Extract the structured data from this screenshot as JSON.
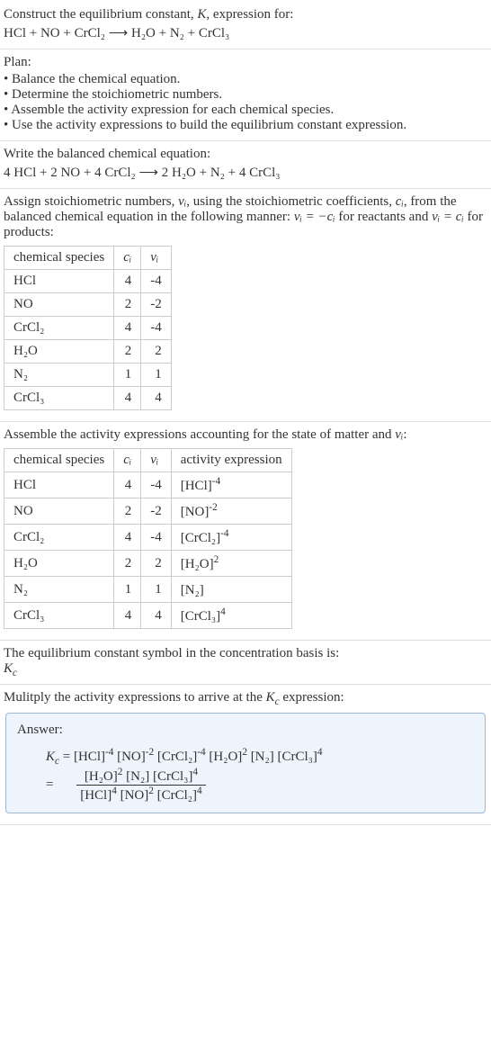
{
  "intro": {
    "line1_a": "Construct the equilibrium constant, ",
    "line1_b": ", expression for:",
    "K": "K",
    "equation": "HCl + NO + CrCl₂  ⟶  H₂O + N₂ + CrCl₃"
  },
  "plan": {
    "heading": "Plan:",
    "items": [
      "Balance the chemical equation.",
      "Determine the stoichiometric numbers.",
      "Assemble the activity expression for each chemical species.",
      "Use the activity expressions to build the equilibrium constant expression."
    ]
  },
  "balanced": {
    "heading": "Write the balanced chemical equation:",
    "equation": "4 HCl + 2 NO + 4 CrCl₂  ⟶  2 H₂O + N₂ + 4 CrCl₃"
  },
  "stoich": {
    "text_a": "Assign stoichiometric numbers, ",
    "nu_i": "νᵢ",
    "text_b": ", using the stoichiometric coefficients, ",
    "c_i": "cᵢ",
    "text_c": ", from the balanced chemical equation in the following manner: ",
    "rel1": "νᵢ = −cᵢ",
    "text_d": " for reactants and ",
    "rel2": "νᵢ = cᵢ",
    "text_e": " for products:",
    "headers": {
      "species": "chemical species",
      "c": "cᵢ",
      "nu": "νᵢ"
    },
    "rows": [
      {
        "species": "HCl",
        "c": "4",
        "nu": "-4"
      },
      {
        "species": "NO",
        "c": "2",
        "nu": "-2"
      },
      {
        "species": "CrCl₂",
        "c": "4",
        "nu": "-4"
      },
      {
        "species": "H₂O",
        "c": "2",
        "nu": "2"
      },
      {
        "species": "N₂",
        "c": "1",
        "nu": "1"
      },
      {
        "species": "CrCl₃",
        "c": "4",
        "nu": "4"
      }
    ]
  },
  "activity": {
    "heading_a": "Assemble the activity expressions accounting for the state of matter and ",
    "nu_i": "νᵢ",
    "heading_b": ":",
    "headers": {
      "species": "chemical species",
      "c": "cᵢ",
      "nu": "νᵢ",
      "act": "activity expression"
    },
    "rows": [
      {
        "species": "HCl",
        "c": "4",
        "nu": "-4",
        "base": "[HCl]",
        "exp": "-4"
      },
      {
        "species": "NO",
        "c": "2",
        "nu": "-2",
        "base": "[NO]",
        "exp": "-2"
      },
      {
        "species": "CrCl₂",
        "c": "4",
        "nu": "-4",
        "base": "[CrCl₂]",
        "exp": "-4"
      },
      {
        "species": "H₂O",
        "c": "2",
        "nu": "2",
        "base": "[H₂O]",
        "exp": "2"
      },
      {
        "species": "N₂",
        "c": "1",
        "nu": "1",
        "base": "[N₂]",
        "exp": ""
      },
      {
        "species": "CrCl₃",
        "c": "4",
        "nu": "4",
        "base": "[CrCl₃]",
        "exp": "4"
      }
    ]
  },
  "symbol": {
    "line1": "The equilibrium constant symbol in the concentration basis is:",
    "Kc": "K",
    "Kc_sub": "c"
  },
  "multiply": {
    "text_a": "Mulitply the activity expressions to arrive at the ",
    "Kc": "K",
    "Kc_sub": "c",
    "text_b": " expression:"
  },
  "answer": {
    "label": "Answer:",
    "Kc": "K",
    "Kc_sub": "c",
    "eq": " = ",
    "terms": [
      {
        "base": "[HCl]",
        "exp": "-4"
      },
      {
        "base": "[NO]",
        "exp": "-2"
      },
      {
        "base": "[CrCl₂]",
        "exp": "-4"
      },
      {
        "base": "[H₂O]",
        "exp": "2"
      },
      {
        "base": "[N₂]",
        "exp": ""
      },
      {
        "base": "[CrCl₃]",
        "exp": "4"
      }
    ],
    "eq2": "= ",
    "frac_num": [
      {
        "base": "[H₂O]",
        "exp": "2"
      },
      {
        "base": "[N₂]",
        "exp": ""
      },
      {
        "base": "[CrCl₃]",
        "exp": "4"
      }
    ],
    "frac_den": [
      {
        "base": "[HCl]",
        "exp": "4"
      },
      {
        "base": "[NO]",
        "exp": "2"
      },
      {
        "base": "[CrCl₂]",
        "exp": "4"
      }
    ]
  }
}
